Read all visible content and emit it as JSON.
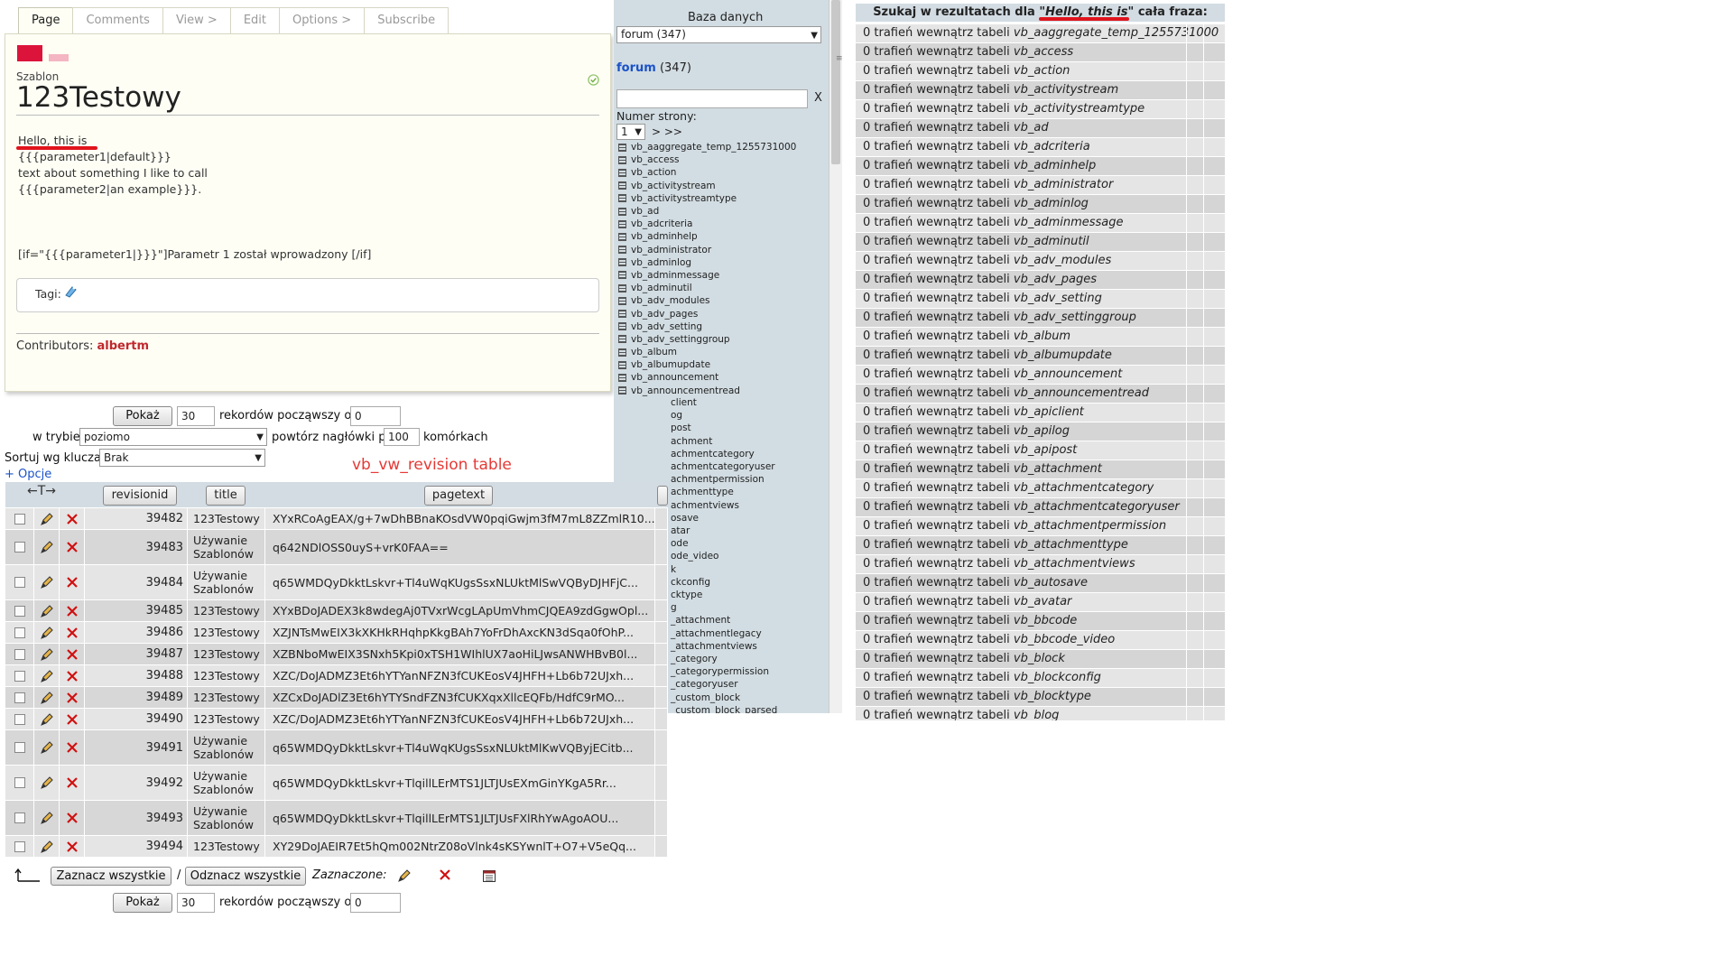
{
  "wiki": {
    "tabs": [
      "Page",
      "Comments",
      "View >",
      "Edit",
      "Options >",
      "Subscribe"
    ],
    "active_tab": 0,
    "label": "Szablon",
    "title": "123Testowy",
    "body_lines": [
      "Hello, this is",
      "{{{parameter1|default}}}",
      "text about something I like to call",
      "{{{parameter2|an example}}}."
    ],
    "if_line": "[if=\"{{{parameter1|}}}\"]Parametr 1 został wprowadzony [/if]",
    "tags_label": "Tagi:",
    "contributors_label": "Contributors:",
    "contributor": "albertm"
  },
  "dbnav": {
    "header": "Baza danych",
    "db_select": "forum (347)",
    "db_link": "forum",
    "db_count": "(347)",
    "filter_clear": "X",
    "page_label": "Numer strony:",
    "page_value": "1",
    "page_next": "> >>",
    "tables": [
      "vb_aaggregate_temp_1255731000",
      "vb_access",
      "vb_action",
      "vb_activitystream",
      "vb_activitystreamtype",
      "vb_ad",
      "vb_adcriteria",
      "vb_adminhelp",
      "vb_administrator",
      "vb_adminlog",
      "vb_adminmessage",
      "vb_adminutil",
      "vb_adv_modules",
      "vb_adv_pages",
      "vb_adv_setting",
      "vb_adv_settinggroup",
      "vb_album",
      "vb_albumupdate",
      "vb_announcement",
      "vb_announcementread"
    ],
    "tables_cut": [
      "client",
      "og",
      "post",
      "achment",
      "achmentcategory",
      "achmentcategoryuser",
      "achmentpermission",
      "achmenttype",
      "achmentviews",
      "osave",
      "atar",
      "ode",
      "ode_video",
      "k",
      "ckconfig",
      "cktype",
      "g",
      "_attachment",
      "_attachmentlegacy",
      "_attachmentviews",
      "_category",
      "_categorypermission",
      "_categoryuser",
      "_custom_block",
      "_custom_block_parsed"
    ]
  },
  "controls": {
    "show_button": "Pokaż",
    "rows_value": "30",
    "records_label": "rekordów począwszy od",
    "offset_value": "0",
    "mode_label": "w trybie",
    "mode_value": "poziomo",
    "repeat_label": "powtórz nagłówki po",
    "repeat_value": "100",
    "cells_label": "komórkach",
    "sort_label": "Sortuj wg klucza:",
    "sort_value": "Brak",
    "table_title": "vb_vw_revision table",
    "options_link": "+ Opcje",
    "col_arrows": "←T→",
    "columns": [
      "revisionid",
      "title",
      "pagetext"
    ]
  },
  "rows": [
    {
      "id": "39482",
      "title": "123Testowy",
      "text": "XYxRCoAgEAX/g+7wDhBBnaKOsdVW0pqiGwjm3fM7mL8ZZmlR10..."
    },
    {
      "id": "39483",
      "title": "Używanie Szablonów",
      "text": "q642NDlOSS0uyS+vrK0FAA=="
    },
    {
      "id": "39484",
      "title": "Używanie Szablonów",
      "text": "q65WMDQyDkktLskvr+Tl4uWqKUgsSsxNLUktMlSwVQByDJHFjC..."
    },
    {
      "id": "39485",
      "title": "123Testowy",
      "text": "XYxBDoJADEX3k8wdegAj0TVxrWcgLApUmVhmCJQEA9zdGgwOpl..."
    },
    {
      "id": "39486",
      "title": "123Testowy",
      "text": "XZJNTsMwEIX3kXKHkRHqhpKkgBAh7YoFrDhAxcKN3dSqa0fOhP..."
    },
    {
      "id": "39487",
      "title": "123Testowy",
      "text": "XZBNboMwEIX3SNxh5Kpi0xTSH1WIhlUX7aoHiLJwsANWHBvB0l..."
    },
    {
      "id": "39488",
      "title": "123Testowy",
      "text": "XZC/DoJADMZ3Et6hYTYanNFZN3fCUKEosV4JHFH+Lb6b72UJxh..."
    },
    {
      "id": "39489",
      "title": "123Testowy",
      "text": "XZCxDoJADlZ3Et6hYTYSndFZN3fCUKXqxXllcEQFb/HdfC9rMO..."
    },
    {
      "id": "39490",
      "title": "123Testowy",
      "text": "XZC/DoJADMZ3Et6hYTYanNFZN3fCUKEosV4JHFH+Lb6b72UJxh..."
    },
    {
      "id": "39491",
      "title": "Używanie Szablonów",
      "text": "q65WMDQyDkktLskvr+Tl4uWqKUgsSsxNLUktMlKwVQByjECitb..."
    },
    {
      "id": "39492",
      "title": "Używanie Szablonów",
      "text": "q65WMDQyDkktLskvr+TlqillLErMTS1JLTJUsEXmGinYKgA5Rr..."
    },
    {
      "id": "39493",
      "title": "Używanie Szablonów",
      "text": "q65WMDQyDkktLskvr+TlqillLErMTS1JLTJUsFXlRhYwAgoAOU..."
    },
    {
      "id": "39494",
      "title": "123Testowy",
      "text": "XY29DoJAEIR7Et5hQm002NtrZ08oVlnk4sKSYwnlT+O7+V5eQq..."
    }
  ],
  "footer": {
    "select_all": "Zaznacz wszystkie",
    "separator": "/",
    "deselect_all": "Odznacz wszystkie",
    "selected_label": "Zaznaczone:",
    "show_button": "Pokaż",
    "rows_value": "30",
    "records_label": "rekordów począwszy od",
    "offset_value": "0"
  },
  "results": {
    "head_prefix": "Szukaj w rezultatach dla",
    "phrase": "\"Hello, this is\"",
    "head_suffix": "cała fraza:",
    "row_prefix": "0 trafień wewnątrz tabeli",
    "tables": [
      "vb_aaggregate_temp_1255731000",
      "vb_access",
      "vb_action",
      "vb_activitystream",
      "vb_activitystreamtype",
      "vb_ad",
      "vb_adcriteria",
      "vb_adminhelp",
      "vb_administrator",
      "vb_adminlog",
      "vb_adminmessage",
      "vb_adminutil",
      "vb_adv_modules",
      "vb_adv_pages",
      "vb_adv_setting",
      "vb_adv_settinggroup",
      "vb_album",
      "vb_albumupdate",
      "vb_announcement",
      "vb_announcementread",
      "vb_apiclient",
      "vb_apilog",
      "vb_apipost",
      "vb_attachment",
      "vb_attachmentcategory",
      "vb_attachmentcategoryuser",
      "vb_attachmentpermission",
      "vb_attachmenttype",
      "vb_attachmentviews",
      "vb_autosave",
      "vb_avatar",
      "vb_bbcode",
      "vb_bbcode_video",
      "vb_block",
      "vb_blockconfig",
      "vb_blocktype",
      "vb_blog"
    ]
  },
  "colors": {
    "accent_red": "#e0141c",
    "link_blue": "#1a52c8",
    "header_bg": "#d3dce3",
    "nav_bg": "#d2dde3"
  }
}
